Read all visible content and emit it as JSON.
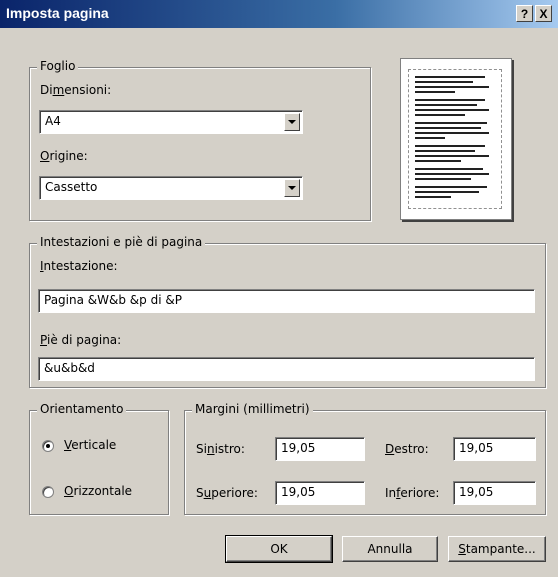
{
  "window": {
    "title": "Imposta pagina",
    "help_label": "?",
    "close_label": "X"
  },
  "foglio": {
    "legend": "Foglio",
    "dimensioni": {
      "label_pre": "Di",
      "label_mnemonic": "m",
      "label_post": "ensioni:",
      "value": "A4"
    },
    "origine": {
      "label_pre": "",
      "label_mnemonic": "O",
      "label_post": "rigine:",
      "value": "Cassetto"
    }
  },
  "header_footer": {
    "legend": "Intestazioni e piè di pagina",
    "header": {
      "label_mnemonic": "I",
      "label_post": "ntestazione:",
      "value": "Pagina &W&b &p di &P"
    },
    "footer": {
      "label_mnemonic": "P",
      "label_post": "iè di pagina:",
      "value": "&u&b&d"
    }
  },
  "orientation": {
    "legend": "Orientamento",
    "portrait": {
      "label_mnemonic": "V",
      "label_post": "erticale",
      "selected": true
    },
    "landscape": {
      "label_mnemonic": "O",
      "label_post": "rizzontale",
      "selected": false
    }
  },
  "margins": {
    "legend": "Margini (millimetri)",
    "left": {
      "label_pre": "Si",
      "label_mnemonic": "n",
      "label_post": "istro:",
      "value": "19,05"
    },
    "right": {
      "label_pre": "",
      "label_mnemonic": "D",
      "label_post": "estro:",
      "value": "19,05"
    },
    "top": {
      "label_pre": "S",
      "label_mnemonic": "u",
      "label_post": "periore:",
      "value": "19,05"
    },
    "bottom": {
      "label_pre": "In",
      "label_mnemonic": "f",
      "label_post": "eriore:",
      "value": "19,05"
    }
  },
  "buttons": {
    "ok": "OK",
    "cancel": "Annulla",
    "print_mnemonic": "S",
    "print_post": "tampante..."
  }
}
